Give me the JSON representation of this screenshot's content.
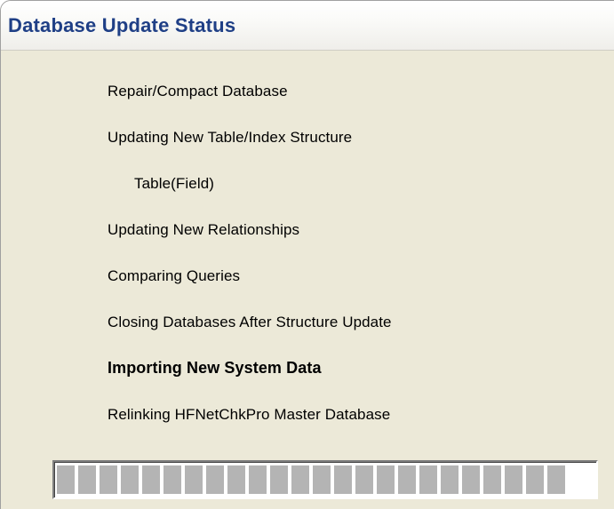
{
  "window": {
    "title": "Database Update Status"
  },
  "steps": [
    {
      "label": "Repair/Compact Database",
      "status": "done",
      "bold": false
    },
    {
      "label": "Updating New Table/Index Structure",
      "status": "done",
      "bold": false
    },
    {
      "label": "Table(Field)",
      "status": "done",
      "bold": false
    },
    {
      "label": "Updating New Relationships",
      "status": "done",
      "bold": false
    },
    {
      "label": "Comparing Queries",
      "status": "done",
      "bold": false
    },
    {
      "label": "Closing Databases After Structure Update",
      "status": "done",
      "bold": false
    },
    {
      "label": "Importing New System Data",
      "status": "active",
      "bold": true
    },
    {
      "label": "Relinking HFNetChkPro Master Database",
      "status": "pending",
      "bold": false
    }
  ],
  "progress": {
    "fraction": 0.97,
    "block_color": "#b4b4b4"
  }
}
